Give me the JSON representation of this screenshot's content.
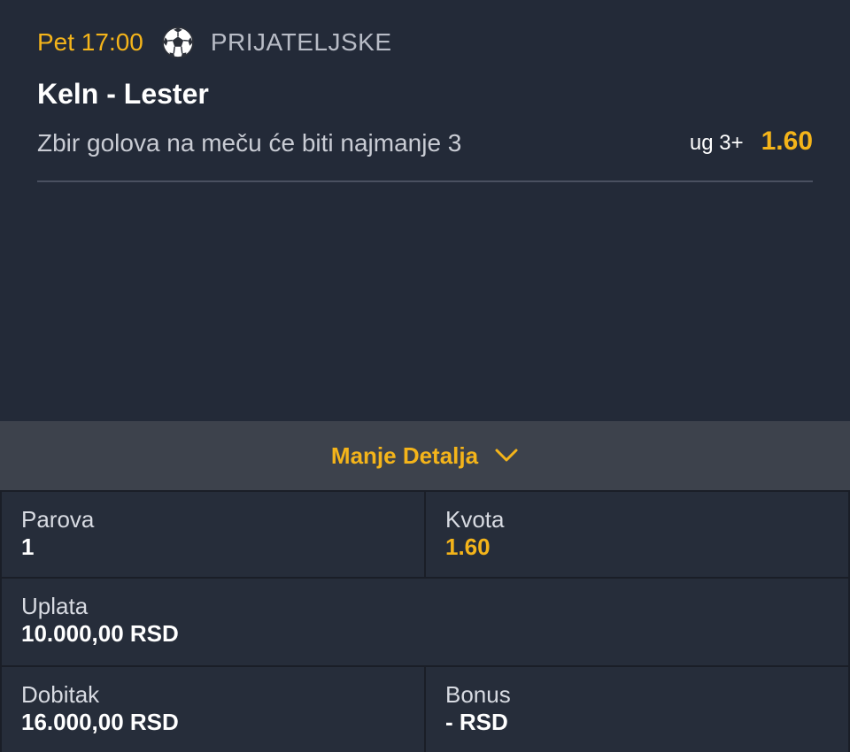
{
  "ticket": {
    "time": "Pet 17:00",
    "sport_icon": "soccer-ball-icon",
    "league": "PRIJATELJSKE",
    "match": "Keln - Lester",
    "bet_description": "Zbir golova na meču će biti najmanje 3",
    "pick": "ug 3+",
    "odd": "1.60"
  },
  "toggle": {
    "label": "Manje Detalja",
    "icon": "chevron-down-icon"
  },
  "summary": {
    "parova_label": "Parova",
    "parova_value": "1",
    "kvota_label": "Kvota",
    "kvota_value": "1.60",
    "uplata_label": "Uplata",
    "uplata_value": "10.000,00 RSD",
    "dobitak_label": "Dobitak",
    "dobitak_value": "16.000,00 RSD",
    "bonus_label": "Bonus",
    "bonus_value": "- RSD"
  },
  "colors": {
    "accent": "#f4b41a",
    "background": "#232937",
    "toggle_bg": "#3d424c",
    "cell_bg": "#262d3a"
  }
}
